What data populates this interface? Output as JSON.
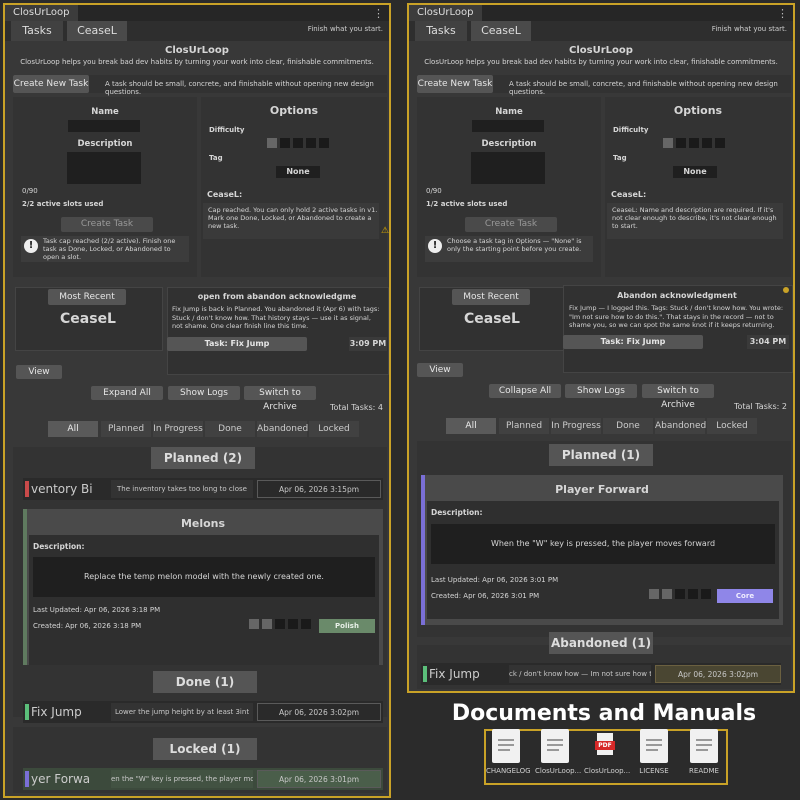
{
  "left": {
    "window_title": "ClosUrLoop",
    "kebab": "⋮",
    "tabs": [
      "Tasks",
      "CeaseL"
    ],
    "motto": "Finish what you start.",
    "app_name": "ClosUrLoop",
    "tagline": "ClosUrLoop helps you break bad dev habits by turning your work into clear, finishable commitments.",
    "create_new_task_label": "Create New Task",
    "create_hint": "A task should be small, concrete, and finishable without opening new design questions.",
    "name_label": "Name",
    "description_label": "Description",
    "char_count": "0/90",
    "slots": "2/2 active slots used",
    "create_task_label": "Create Task",
    "info_text": "Task cap reached (2/2 active). Finish one task as Done, Locked, or Abandoned to open a slot.",
    "options_title": "Options",
    "difficulty_label": "Difficulty",
    "tag_label": "Tag",
    "tag_value": "None",
    "ceasel_label": "CeaseL:",
    "ceasel_message": "Cap reached. You can only hold 2 active tasks in v1. Mark one Done, Locked, or Abandoned to create a new task.",
    "most_recent_label": "Most Recent",
    "most_recent_value": "CeaseL",
    "message_title": "open from abandon acknowledgme",
    "message_body": "Fix Jump is back in Planned. You abandoned it (Apr 6) with tags: Stuck / don't know how. That history stays — use it as signal, not shame. One clear finish line this time.",
    "task_link": "Task: Fix Jump",
    "msg_time": "3:09 PM",
    "view_label": "View",
    "expand_label": "Expand All",
    "show_logs_label": "Show Logs",
    "archive_label": "Switch to Archive",
    "total": "Total Tasks: 4",
    "filters": [
      "All",
      "Planned",
      "In Progress",
      "Done",
      "Abandoned",
      "Locked"
    ],
    "planned_header": "Planned (2)",
    "row1": {
      "name": "ventory Bi",
      "desc": "The inventory takes too long to close",
      "date": "Apr 06, 2026 3:15pm"
    },
    "melons": {
      "title": "Melons",
      "desc_label": "Description:",
      "desc": "Replace the temp melon model with the newly created one.",
      "last_updated": "Last Updated: Apr 06, 2026 3:18 PM",
      "created": "Created: Apr 06, 2026 3:18 PM",
      "tag": "Polish"
    },
    "done_header": "Done (1)",
    "row_done": {
      "name": "Fix Jump",
      "desc": "Lower the jump height by at least 3int",
      "date": "Apr 06, 2026 3:02pm"
    },
    "locked_header": "Locked (1)",
    "row_locked": {
      "name": "yer Forwa",
      "desc": "en the \"W\" key is pressed, the player moves",
      "date": "Apr 06, 2026 3:01pm"
    }
  },
  "right": {
    "window_title": "ClosUrLoop",
    "kebab": "⋮",
    "tabs": [
      "Tasks",
      "CeaseL"
    ],
    "motto": "Finish what you start.",
    "app_name": "ClosUrLoop",
    "tagline": "ClosUrLoop helps you break bad dev habits by turning your work into clear, finishable commitments.",
    "create_new_task_label": "Create New Task",
    "create_hint": "A task should be small, concrete, and finishable without opening new design questions.",
    "name_label": "Name",
    "description_label": "Description",
    "char_count": "0/90",
    "slots": "1/2 active slots used",
    "create_task_label": "Create Task",
    "info_text": "Choose a task tag in Options — \"None\" is only the starting point before you create.",
    "options_title": "Options",
    "difficulty_label": "Difficulty",
    "tag_label": "Tag",
    "tag_value": "None",
    "ceasel_label": "CeaseL:",
    "ceasel_message": "CeaseL: Name and description are required. If it's not clear enough to describe, it's not clear enough to start.",
    "most_recent_label": "Most Recent",
    "most_recent_value": "CeaseL",
    "message_title": "Abandon acknowledgment",
    "message_body": "Fix Jump — I logged this. Tags: Stuck / don't know how. You wrote: \"Im not sure how to do this.\". That stays in the record — not to shame you, so we can spot the same knot if it keeps returning.",
    "task_link": "Task: Fix Jump",
    "msg_time": "3:04 PM",
    "view_label": "View",
    "collapse_label": "Collapse All",
    "show_logs_label": "Show Logs",
    "archive_label": "Switch to Archive",
    "total": "Total Tasks: 2",
    "filters": [
      "All",
      "Planned",
      "In Progress",
      "Done",
      "Abandoned",
      "Locked"
    ],
    "planned_header": "Planned (1)",
    "player": {
      "title": "Player Forward",
      "desc_label": "Description:",
      "desc": "When the \"W\" key is pressed, the player moves forward",
      "last_updated": "Last Updated: Apr 06, 2026 3:01 PM",
      "created": "Created: Apr 06, 2026 3:01 PM",
      "tag": "Core"
    },
    "abandoned_header": "Abandoned (1)",
    "row_ab": {
      "name": "Fix Jump",
      "desc": "ck / don't know how — Im not sure how to d",
      "date": "Apr 06, 2026 3:02pm"
    }
  },
  "docs": {
    "title": "Documents and Manuals",
    "items": [
      "CHANGELOG",
      "ClosUrLoop...",
      "ClosUrLoop...",
      "LICENSE",
      "README"
    ],
    "pdf_badge": "PDF"
  },
  "colors": {
    "accent_border": "#c9a227",
    "planned_bar": "#c94a4a",
    "green_bar": "#5bbf7a",
    "purple_bar": "#7a6fd6",
    "polish_tag": "#5f7a5f",
    "core_tag": "#8f86e8",
    "warning": "#e0b000"
  }
}
